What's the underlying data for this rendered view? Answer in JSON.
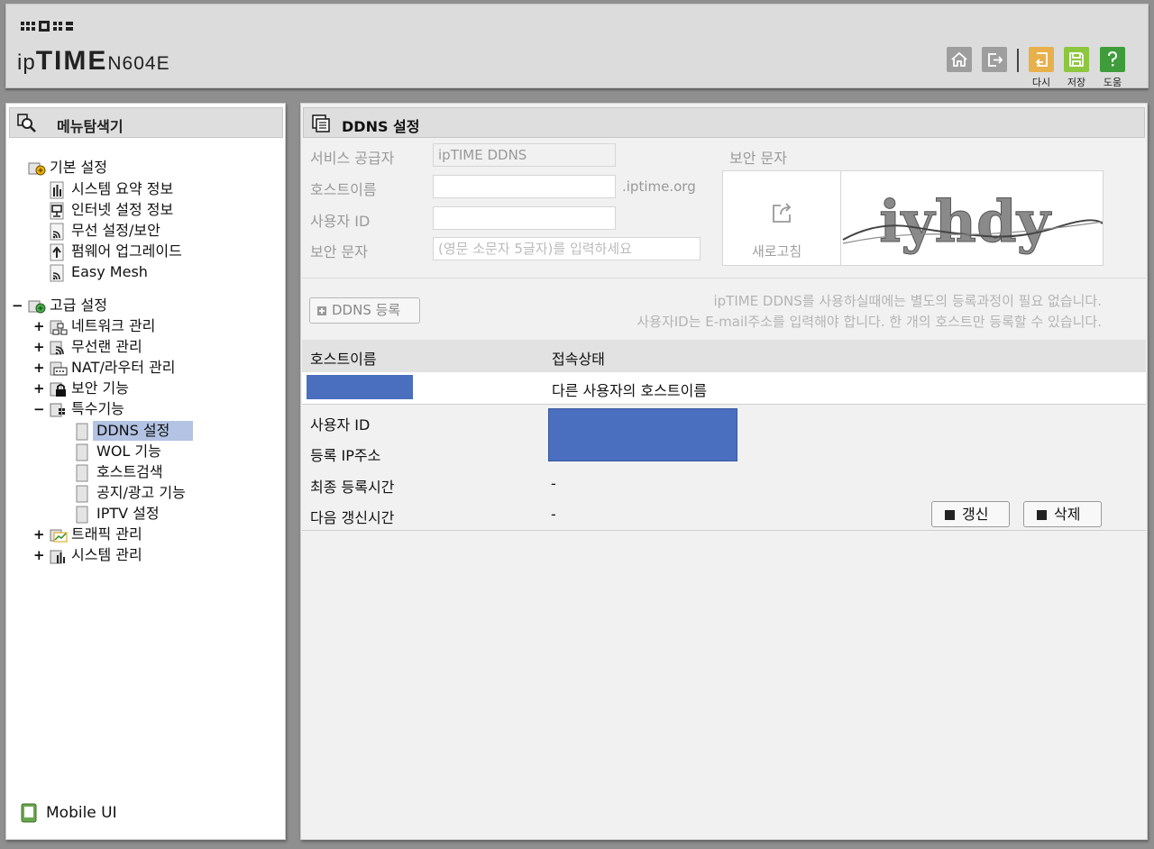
{
  "header": {
    "brand_prefix": "ip",
    "brand_name": "TIME",
    "model": "N604E",
    "toolbar": {
      "home_icon": "home-icon",
      "logout_icon": "logout-icon",
      "reset_label": "다시",
      "save_label": "저장",
      "help_label": "도움"
    }
  },
  "sidebar": {
    "title": "메뉴탐색기",
    "basic": {
      "label": "기본 설정",
      "items": [
        "시스템 요약 정보",
        "인터넷 설정 정보",
        "무선 설정/보안",
        "펌웨어 업그레이드",
        "Easy Mesh"
      ]
    },
    "advanced": {
      "label": "고급 설정",
      "collapse_symbol": "−",
      "expand_symbol": "+",
      "network": "네트워크 관리",
      "wireless": "무선랜 관리",
      "nat": "NAT/라우터 관리",
      "security": "보안 기능",
      "special": "특수기능",
      "special_items": [
        "DDNS 설정",
        "WOL 기능",
        "호스트검색",
        "공지/광고 기능",
        "IPTV 설정"
      ],
      "traffic": "트래픽 관리",
      "system": "시스템 관리"
    },
    "mobile_ui": "Mobile UI"
  },
  "main": {
    "title": "DDNS 설정",
    "form": {
      "provider_label": "서비스 공급자",
      "provider_value": "ipTIME DDNS",
      "host_label": "호스트이름",
      "host_value": "",
      "host_suffix": ".iptime.org",
      "user_label": "사용자 ID",
      "user_value": "",
      "captcha_label": "보안 문자",
      "captcha_placeholder": "(영문 소문자 5글자)를 입력하세요",
      "captcha_title": "보안 문자",
      "refresh_label": "새로고침",
      "captcha_text": "iyhdy"
    },
    "register_button": "DDNS 등록",
    "notice_line1": "ipTIME DDNS를 사용하실때에는 별도의 등록과정이 필요 없습니다.",
    "notice_line2": "사용자ID는 E-mail주소를 입력해야 합니다. 한 개의 호스트만 등록할 수 있습니다.",
    "table": {
      "columns": [
        "호스트이름",
        "접속상태"
      ],
      "rows": [
        {
          "host": "",
          "status": "다른 사용자의 호스트이름"
        }
      ]
    },
    "details": {
      "user_id_label": "사용자 ID",
      "ip_label": "등록 IP주소",
      "last_label": "최종 등록시간",
      "last_value": "-",
      "next_label": "다음 갱신시간",
      "next_value": "-"
    },
    "refresh_button": "갱신",
    "delete_button": "삭제"
  },
  "colors": {
    "redaction": "#4a6fbf",
    "selection": "#b3c3e3",
    "save_accent": "#8dc63f",
    "reset_accent": "#e8b04a",
    "help_accent": "#3f9c3a"
  }
}
